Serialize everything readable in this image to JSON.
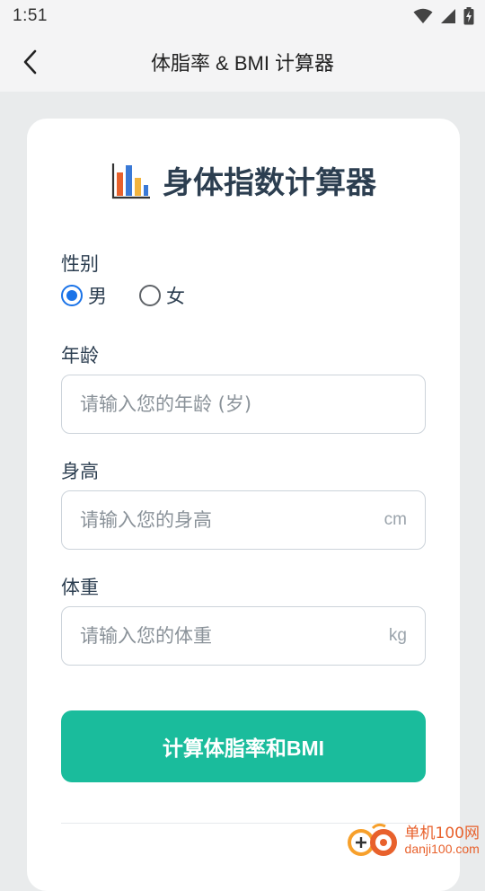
{
  "status_bar": {
    "time": "1:51"
  },
  "app_bar": {
    "title": "体脂率 & BMI 计算器"
  },
  "card": {
    "title": "身体指数计算器",
    "gender": {
      "label": "性别",
      "options": [
        "男",
        "女"
      ],
      "selected": "男"
    },
    "age": {
      "label": "年龄",
      "placeholder": "请输入您的年龄 (岁)"
    },
    "height": {
      "label": "身高",
      "placeholder": "请输入您的身高",
      "unit": "cm"
    },
    "weight": {
      "label": "体重",
      "placeholder": "请输入您的体重",
      "unit": "kg"
    },
    "calculate_label": "计算体脂率和BMI"
  },
  "watermark": {
    "name": "单机100网",
    "url": "danji100.com"
  },
  "colors": {
    "accent": "#1abc9c",
    "radio_selected": "#1a73e8",
    "title_text": "#2c3e50",
    "background": "#e9ebec"
  }
}
